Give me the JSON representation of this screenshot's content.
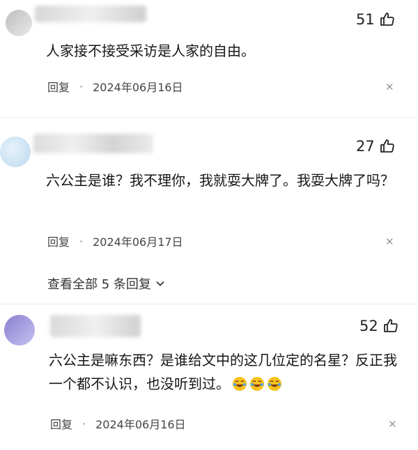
{
  "comments": [
    {
      "text": "人家接不接受采访是人家的自由。",
      "likes": "51",
      "reply_label": "回复",
      "separator": "·",
      "date": "2024年06月16日"
    },
    {
      "text": "六公主是谁？我不理你，我就耍大牌了。我耍大牌了吗？",
      "likes": "27",
      "reply_label": "回复",
      "separator": "·",
      "date": "2024年06月17日",
      "expand_label": "查看全部 5 条回复"
    },
    {
      "text": "六公主是嘛东西？是谁给文中的这几位定的名星？反正我一个都不认识，也没听到过。",
      "likes": "52",
      "reply_label": "回复",
      "separator": "·",
      "date": "2024年06月16日",
      "emoji": "laugh-cry-icon"
    }
  ],
  "colors": {
    "text": "#161616",
    "meta": "#444444",
    "divider": "#ececec"
  }
}
